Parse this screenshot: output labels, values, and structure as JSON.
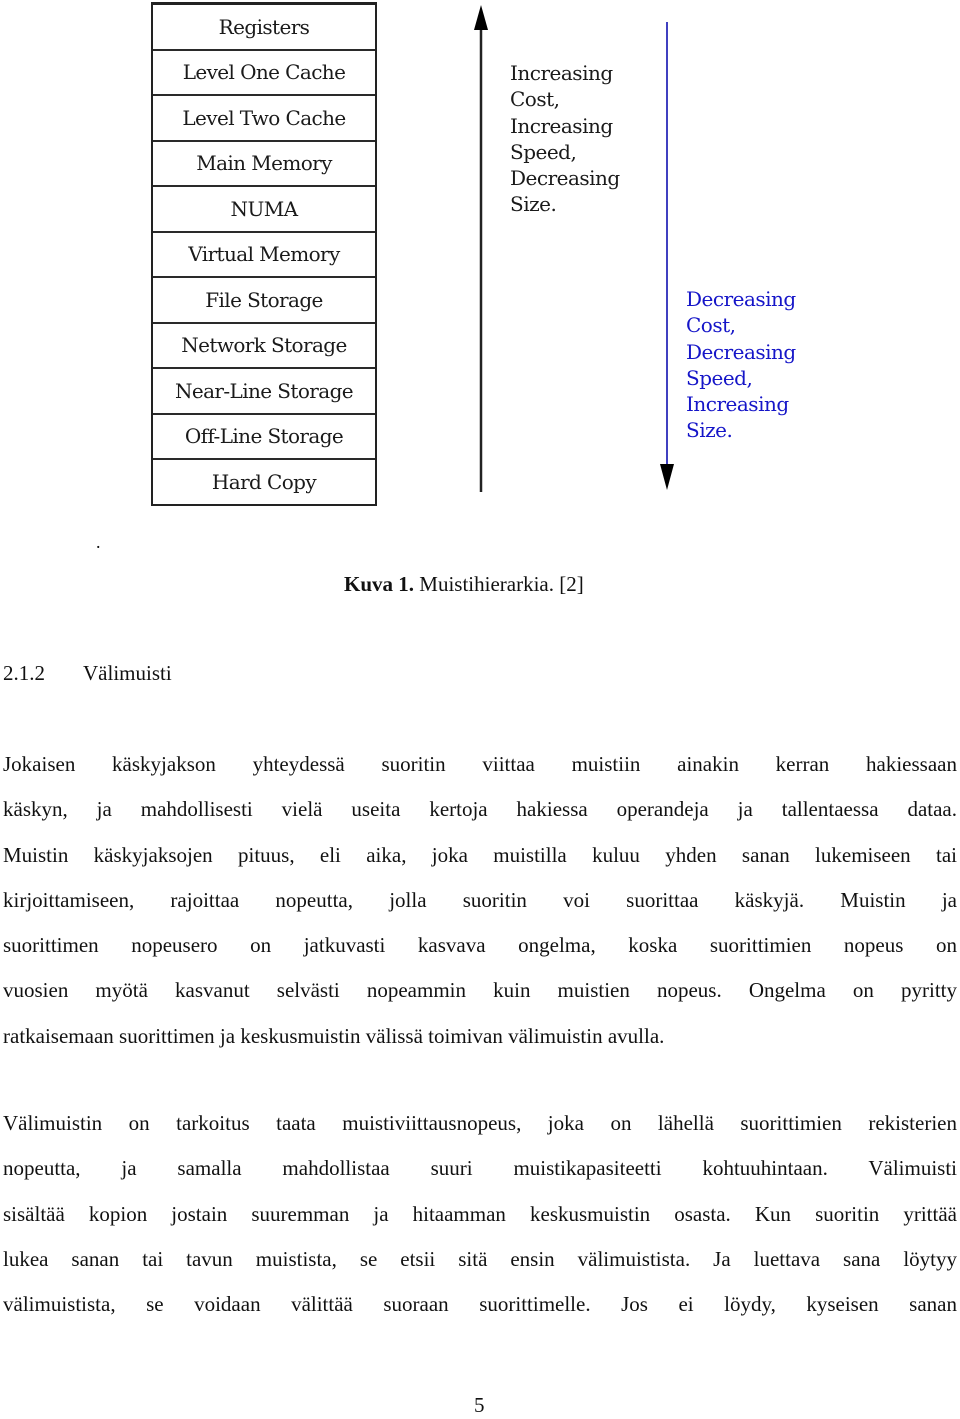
{
  "figure": {
    "hierarchy_levels": [
      "Registers",
      "Level One Cache",
      "Level Two Cache",
      "Main Memory",
      "NUMA",
      "Virtual Memory",
      "File Storage",
      "Network Storage",
      "Near-Line Storage",
      "Off-Line Storage",
      "Hard Copy"
    ],
    "up_arrow_label": "Increasing\nCost,\nIncreasing\nSpeed,\nDecreasing\nSize.",
    "down_arrow_label": "Decreasing\nCost,\nDecreasing\nSpeed,\nIncreasing\nSize.",
    "colors": {
      "up_label": "#1a1a1a",
      "down_label": "#1515c8",
      "down_arrow_line": "#4040c0",
      "up_arrow_line": "#222222"
    },
    "stray_mark": "."
  },
  "caption": {
    "label": "Kuva 1.",
    "text": " Muistihierarkia. [2]"
  },
  "section": {
    "number": "2.1.2",
    "title": "Välimuisti"
  },
  "paragraphs": [
    {
      "lines": [
        "Jokaisen käskyjakson yhteydessä suoritin viittaa muistiin ainakin kerran hakiessaan",
        "käskyn, ja mahdollisesti vielä useita kertoja hakiessa operandeja ja tallentaessa dataa.",
        "Muistin käskyjaksojen pituus, eli aika, joka muistilla kuluu yhden sanan lukemiseen tai",
        "kirjoittamiseen, rajoittaa nopeutta, jolla suoritin voi suorittaa käskyjä. Muistin ja",
        "suorittimen nopeusero on jatkuvasti kasvava ongelma, koska suorittimien nopeus on",
        "vuosien myötä kasvanut selvästi nopeammin kuin muistien nopeus. Ongelma on pyritty",
        "ratkaisemaan suorittimen ja keskusmuistin välissä toimivan välimuistin avulla."
      ]
    },
    {
      "lines": [
        "Välimuistin on tarkoitus taata muistiviittausnopeus, joka on lähellä suorittimien rekisterien",
        "nopeutta, ja samalla mahdollistaa suuri muistikapasiteetti kohtuuhintaan. Välimuisti",
        "sisältää kopion jostain suuremman ja hitaamman keskusmuistin osasta. Kun suoritin yrittää",
        "lukea sanan tai tavun muistista, se etsii sitä ensin välimuistista. Ja luettava sana löytyy",
        "välimuistista, se voidaan välittää suoraan suorittimelle. Jos ei löydy, kyseisen sanan"
      ]
    }
  ],
  "page_number": "5"
}
